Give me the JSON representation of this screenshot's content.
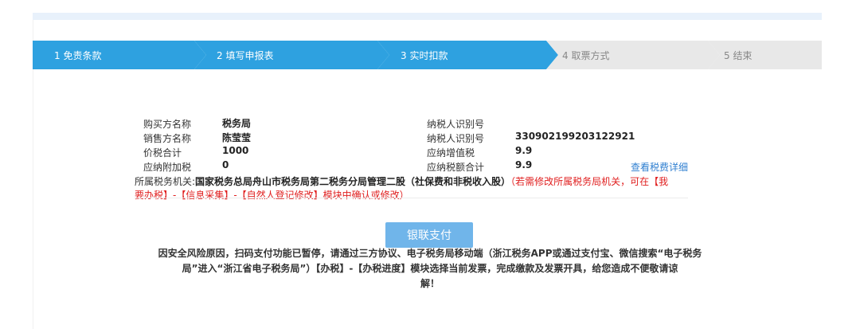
{
  "steps": [
    {
      "label": "1  免责条款",
      "active": true
    },
    {
      "label": "2  填写申报表",
      "active": true
    },
    {
      "label": "3  实时扣款",
      "active": true
    },
    {
      "label": "4  取票方式",
      "active": false
    },
    {
      "label": "5  结束",
      "active": false
    }
  ],
  "colors": {
    "active_step": "#2ea1e0",
    "inactive_step": "#e8e8e8",
    "pay_button": "#70b5ea",
    "link": "#2f7fd0",
    "warning": "#e02020"
  },
  "info": {
    "buyer_label": "购买方名称",
    "buyer_value": "税务局",
    "buyer_tax_id_label": "纳税人识别号",
    "buyer_tax_id_value": "",
    "seller_label": "销售方名称",
    "seller_value": "陈莹莹",
    "seller_tax_id_label": "纳税人识别号",
    "seller_tax_id_value": "330902199203122921",
    "total_label": "价税合计",
    "total_value": "1000",
    "vat_label": "应纳增值税",
    "vat_value": "9.9",
    "surcharge_label": "应纳附加税",
    "surcharge_value": "0",
    "tax_total_label": "应纳税额合计",
    "tax_total_value": "9.9",
    "detail_link": "查看税费详细"
  },
  "tax_office": {
    "label": "所属税务机关:",
    "value": "国家税务总局舟山市税务局第二税务分局管理二股（社保费和非税收入股）",
    "note_line1": "（若需修改所属税务局机关，可在【我",
    "note_line2": "要办税】-【信息采集】-【自然人登记修改】模块中确认或修改）"
  },
  "pay_button": "银联支付",
  "notice": {
    "line1": "因安全风险原因，扫码支付功能已暂停，请通过三方协议、电子税务局移动端（浙江税务APP或通过支付宝、微信搜索“电子税务",
    "line2": "局”进入“浙江省电子税务局”）【办税】-【办税进度】模块选择当前发票，完成缴款及发票开具，给您造成不便敬请谅",
    "line3": "解！"
  }
}
